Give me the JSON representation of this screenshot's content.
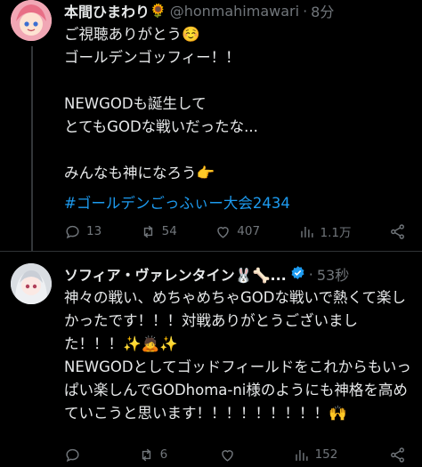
{
  "post1": {
    "name": "本間ひまわり",
    "name_emoji": "🌻",
    "handle": "@honmahimawari",
    "time": "8分",
    "body": "ご視聴ありがとう☺️\nゴールデンゴッフィー！！\n\nNEWGODも誕生して\nとてもGODな戦いだったな...\n\nみんなも神になろう👉",
    "hashtag": "#ゴールデンごっふぃー大会2434",
    "stats": {
      "replies": "13",
      "reposts": "54",
      "likes": "407",
      "views": "1.1万"
    }
  },
  "post2": {
    "name": "ソフィア・ヴァレンタイン🐰🦴...",
    "time": "53秒",
    "body": "神々の戦い、めちゃめちゃGODな戦いで熱くて楽しかったです！！！対戦ありがとうございました！！！✨🙇✨\nNEWGODとしてゴッドフィールドをこれからもいっぱい楽しんでGODhoma-ni様のようにも神格を高めていこうと思います！！！！！！！！！🙌",
    "stats": {
      "replies": "",
      "reposts": "6",
      "likes": "",
      "views": "152"
    }
  },
  "icons": [
    "reply-icon",
    "repost-icon",
    "like-icon",
    "views-icon",
    "share-icon",
    "verified-icon",
    "more-icon"
  ],
  "colors": {
    "background": "#000000",
    "text": "#e7e9ea",
    "muted": "#71767b",
    "accent": "#1d9bf0"
  }
}
